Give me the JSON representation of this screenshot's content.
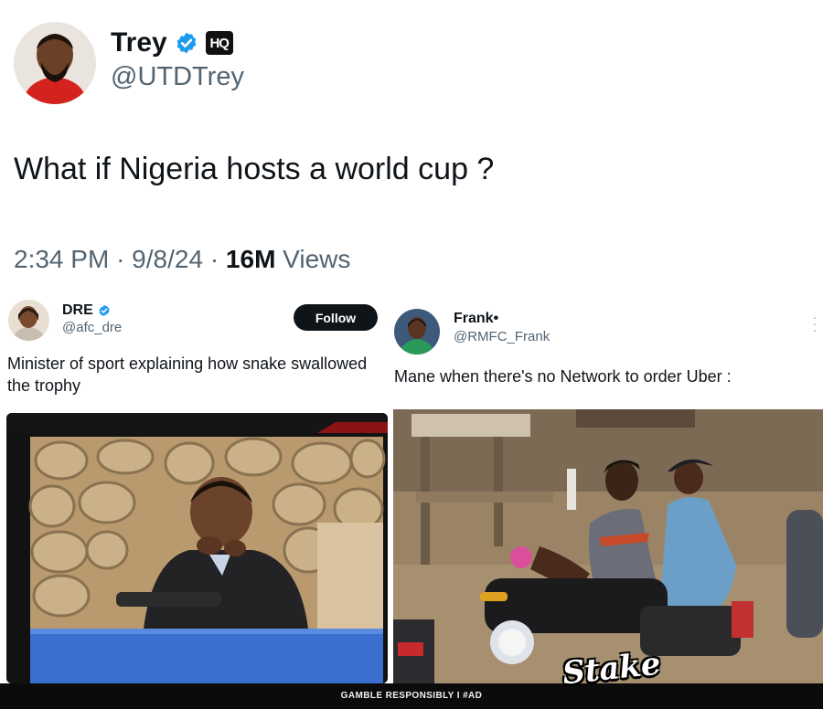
{
  "main_tweet": {
    "author_name": "Trey",
    "author_handle": "@UTDTrey",
    "affiliate_badge": "HQ",
    "text": "What if Nigeria hosts a world cup ?",
    "time": "2:34 PM",
    "date": "9/8/24",
    "views_count": "16M",
    "views_label": "Views",
    "separator": "·",
    "icons": [
      "verified-icon",
      "affiliate-badge"
    ]
  },
  "left_post": {
    "author_name": "DRE",
    "author_handle": "@afc_dre",
    "follow_label": "Follow",
    "text": "Minister of sport explaining how snake swallowed the trophy"
  },
  "right_post": {
    "author_name": "Frank•",
    "author_handle": "@RMFC_Frank",
    "text": "Mane when there's no Network to order Uber :",
    "icons": [
      "more-options-icon"
    ]
  },
  "ad": {
    "text": "GAMBLE RESPONSIBLY  I  #AD",
    "logo": "Stake"
  },
  "colors": {
    "verified": "#1d9bf0",
    "primary_text": "#0f1419",
    "secondary_text": "#536471",
    "follow_bg": "#0f1419",
    "banner_bg": "#0b0b0b"
  }
}
